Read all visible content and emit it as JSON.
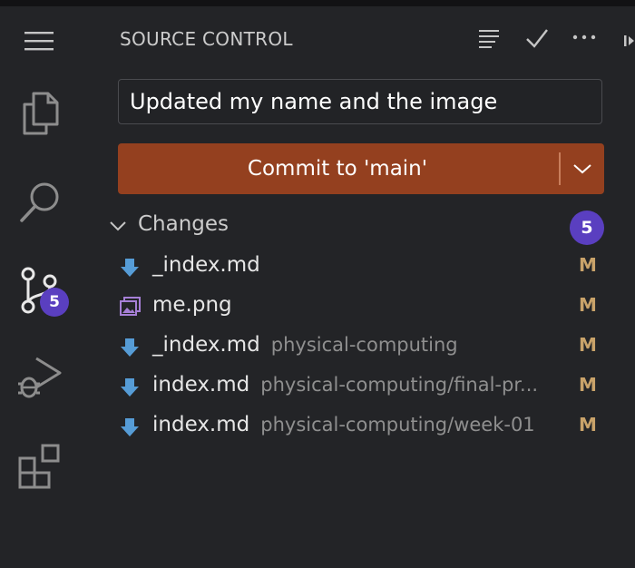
{
  "activity_bar": {
    "source_control_badge": "5"
  },
  "sidebar": {
    "title": "SOURCE CONTROL",
    "commit_message": "Updated my name and the image",
    "commit_button_label": "Commit to 'main'",
    "changes_label": "Changes",
    "changes_count": "5",
    "files": [
      {
        "name": "_index.md",
        "path": "",
        "status": "M",
        "icon": "download-arrow-icon"
      },
      {
        "name": "me.png",
        "path": "",
        "status": "M",
        "icon": "image-icon"
      },
      {
        "name": "_index.md",
        "path": "physical-computing",
        "status": "M",
        "icon": "download-arrow-icon"
      },
      {
        "name": "index.md",
        "path": "physical-computing/final-pr...",
        "status": "M",
        "icon": "download-arrow-icon"
      },
      {
        "name": "index.md",
        "path": "physical-computing/week-01",
        "status": "M",
        "icon": "download-arrow-icon"
      }
    ]
  },
  "colors": {
    "background": "#232427",
    "commit_button": "#94401f",
    "badge": "#5a3fc0",
    "modified_status": "#c9a36a",
    "file_icon": "#569cd6"
  }
}
